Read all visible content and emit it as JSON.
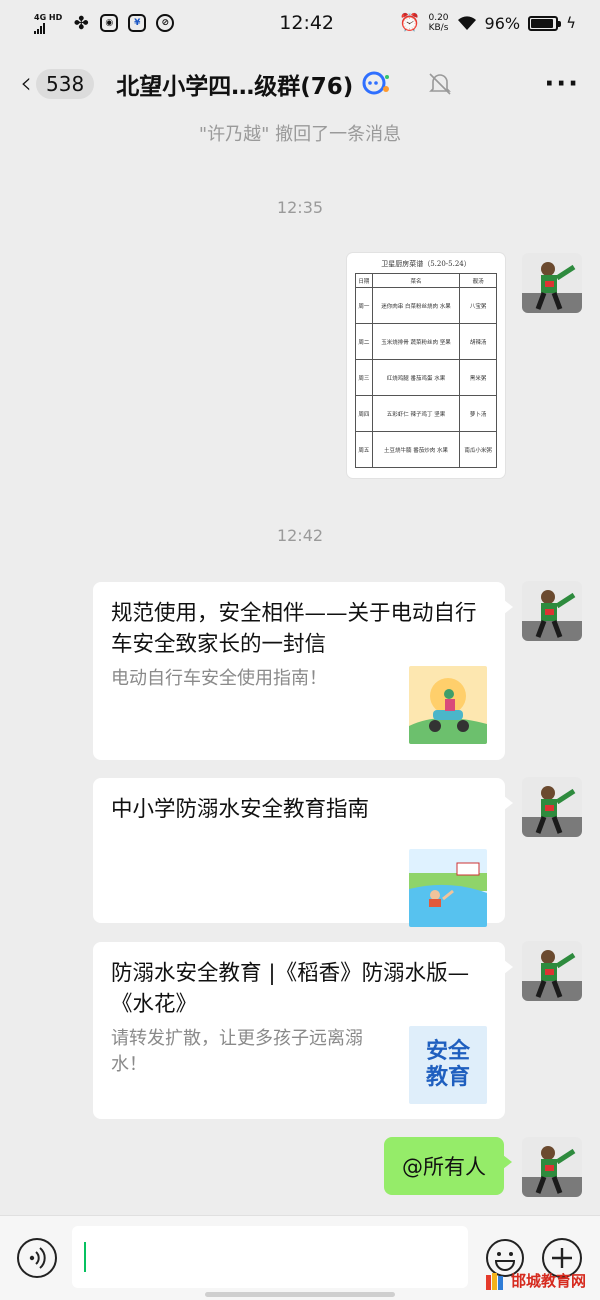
{
  "status_bar": {
    "network": "4G HD",
    "time": "12:42",
    "speed_value": "0.20",
    "speed_unit": "KB/s",
    "battery": "96%"
  },
  "header": {
    "unread_count": "538",
    "title": "北望小学四…级群(76)"
  },
  "recall_notice": "\"许乃越\" 撤回了一条消息",
  "timestamps": [
    "12:35",
    "12:42"
  ],
  "menu_image": {
    "title": "卫星厨房菜谱（5.20-5.24）",
    "headers": [
      "日期",
      "菜名",
      "靓汤"
    ],
    "rows": [
      {
        "day": "周一",
        "dish": "迷你肉串 白菜粉丝烧肉 水果",
        "soup": "八宝粥"
      },
      {
        "day": "周二",
        "dish": "玉米烧排骨 蔬菜粉丝肉 坚果",
        "soup": "胡辣汤"
      },
      {
        "day": "周三",
        "dish": "红烧鸡腿 番茄鸡蛋 水果",
        "soup": "黑米粥"
      },
      {
        "day": "周四",
        "dish": "五彩虾仁 辣子鸡丁 坚果",
        "soup": "萝卜汤"
      },
      {
        "day": "周五",
        "dish": "土豆烧牛腩 番茄炒肉 水果",
        "soup": "南瓜小米粥"
      }
    ]
  },
  "cards": [
    {
      "title": "规范使用，安全相伴——关于电动自行车安全致家长的一封信",
      "desc": "电动自行车安全使用指南！",
      "thumb": "scooter-illustration"
    },
    {
      "title": "中小学防溺水安全教育指南",
      "desc": "",
      "thumb": "swimming-illustration"
    },
    {
      "title": "防溺水安全教育 |《稻香》防溺水版—《水花》",
      "desc": "请转发扩散，让更多孩子远离溺水！",
      "thumb": "safety-education-badge",
      "thumb_text": [
        "安全",
        "教育"
      ]
    }
  ],
  "outgoing_message": "@所有人",
  "watermark": "邯城教育网",
  "colors": {
    "bubble_green": "#95ec69",
    "background": "#ededed",
    "caret": "#07c160"
  }
}
